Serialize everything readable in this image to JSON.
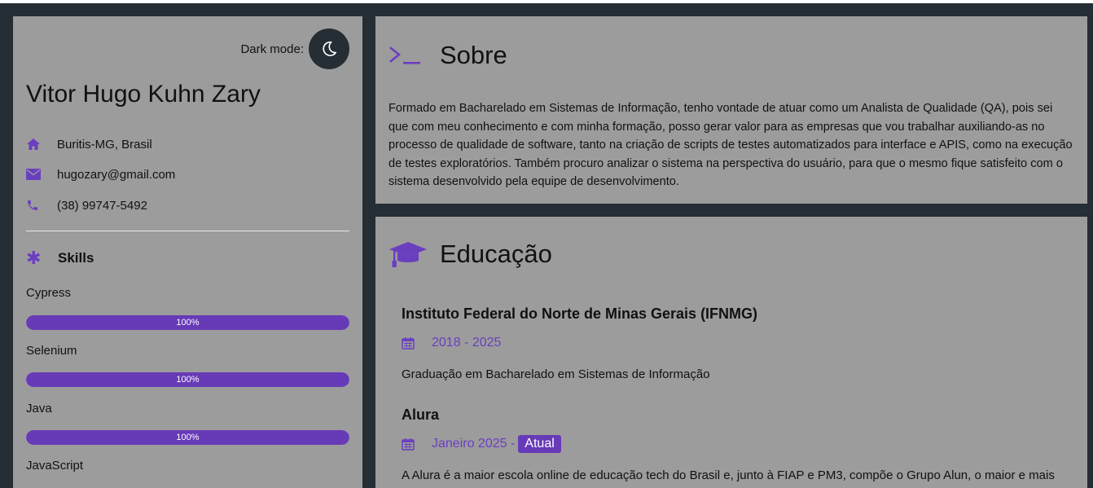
{
  "profile": {
    "dark_mode_label": "Dark mode:",
    "name": "Vitor Hugo Kuhn Zary",
    "location": "Buritis-MG, Brasil",
    "email": "hugozary@gmail.com",
    "phone": "(38) 99747-5492"
  },
  "skills": {
    "title": "Skills",
    "items": [
      {
        "name": "Cypress",
        "level_label": "100%",
        "level": 100
      },
      {
        "name": "Selenium",
        "level_label": "100%",
        "level": 100
      },
      {
        "name": "Java",
        "level_label": "100%",
        "level": 100
      },
      {
        "name": "JavaScript"
      }
    ]
  },
  "about": {
    "title": "Sobre",
    "text": "Formado em Bacharelado em Sistemas de Informação, tenho vontade de atuar como um Analista de Qualidade (QA), pois sei que com meu conhecimento e com minha formação, posso gerar valor para as empresas que vou trabalhar auxiliando-as no processo de qualidade de software, tanto na criação de scripts de testes automatizados para interface e APIS, como na execução de testes exploratórios. Também procuro analizar o sistema na perspectiva do usuário, para que o mesmo fique satisfeito com o sistema desenvolvido pela equipe de desenvolvimento."
  },
  "education": {
    "title": "Educação",
    "entries": [
      {
        "institution": "Instituto Federal do Norte de Minas Gerais (IFNMG)",
        "period": "2018 - 2025",
        "description": "Graduação em Bacharelado em Sistemas de Informação"
      },
      {
        "institution": "Alura",
        "period": "Janeiro 2025 -",
        "badge": "Atual",
        "description": "A Alura é a maior escola online de educação tech do Brasil e, junto à FIAP e PM3, compõe o Grupo Alun, o maior e mais"
      }
    ]
  },
  "colors": {
    "accent": "#673ab7",
    "card_bg": "#9c9c9c",
    "page_bg": "#252e35"
  }
}
